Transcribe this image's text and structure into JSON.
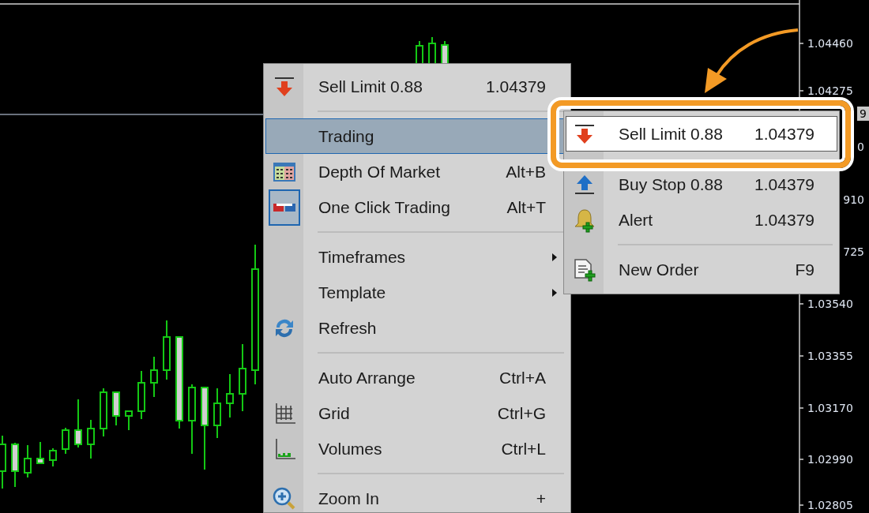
{
  "chart": {
    "price_axis": [
      {
        "kind": "tick",
        "label": "1.04460"
      },
      {
        "kind": "tick",
        "label": "1.04275"
      },
      {
        "kind": "tag",
        "label": "9"
      },
      {
        "kind": "tick",
        "label": "0"
      },
      {
        "kind": "tick",
        "label": "910"
      },
      {
        "kind": "tick",
        "label": "725"
      },
      {
        "kind": "tick",
        "label": "1.03540"
      },
      {
        "kind": "tick",
        "label": "1.03355"
      },
      {
        "kind": "tick",
        "label": "1.03170"
      },
      {
        "kind": "tick",
        "label": "1.02990"
      },
      {
        "kind": "tick",
        "label": "1.02805"
      }
    ]
  },
  "context_menu": {
    "items": [
      {
        "kind": "item",
        "label": "Sell Limit 0.88",
        "shortcut": "1.04379",
        "submenu": false,
        "selected": false,
        "checked": false
      },
      {
        "kind": "separator"
      },
      {
        "kind": "item",
        "label": "Trading",
        "submenu": false,
        "selected": true,
        "checked": false
      },
      {
        "kind": "item",
        "label": "Depth Of Market",
        "shortcut": "Alt+B",
        "submenu": false,
        "selected": false,
        "checked": false
      },
      {
        "kind": "item",
        "label": "One Click Trading",
        "shortcut": "Alt+T",
        "submenu": false,
        "selected": false,
        "checked": true
      },
      {
        "kind": "separator"
      },
      {
        "kind": "item",
        "label": "Timeframes",
        "submenu": true,
        "selected": false,
        "checked": false
      },
      {
        "kind": "item",
        "label": "Template",
        "submenu": true,
        "selected": false,
        "checked": false
      },
      {
        "kind": "item",
        "label": "Refresh",
        "submenu": false,
        "selected": false,
        "checked": false
      },
      {
        "kind": "separator"
      },
      {
        "kind": "item",
        "label": "Auto Arrange",
        "shortcut": "Ctrl+A",
        "submenu": false,
        "selected": false,
        "checked": false
      },
      {
        "kind": "item",
        "label": "Grid",
        "shortcut": "Ctrl+G",
        "submenu": false,
        "selected": false,
        "checked": false
      },
      {
        "kind": "item",
        "label": "Volumes",
        "shortcut": "Ctrl+L",
        "submenu": false,
        "selected": false,
        "checked": false
      },
      {
        "kind": "separator"
      },
      {
        "kind": "item",
        "label": "Zoom In",
        "shortcut": "+",
        "submenu": false,
        "selected": false,
        "checked": false
      }
    ]
  },
  "trading_submenu": {
    "items": [
      {
        "kind": "item",
        "label": "Sell Limit 0.88",
        "shortcut": "1.04379",
        "selected": true
      },
      {
        "kind": "item",
        "label": "Buy Stop 0.88",
        "shortcut": "1.04379",
        "selected": false
      },
      {
        "kind": "item",
        "label": "Alert",
        "shortcut": "1.04379",
        "selected": false
      },
      {
        "kind": "separator"
      },
      {
        "kind": "item",
        "label": "New Order",
        "shortcut": "F9",
        "selected": false
      }
    ]
  }
}
